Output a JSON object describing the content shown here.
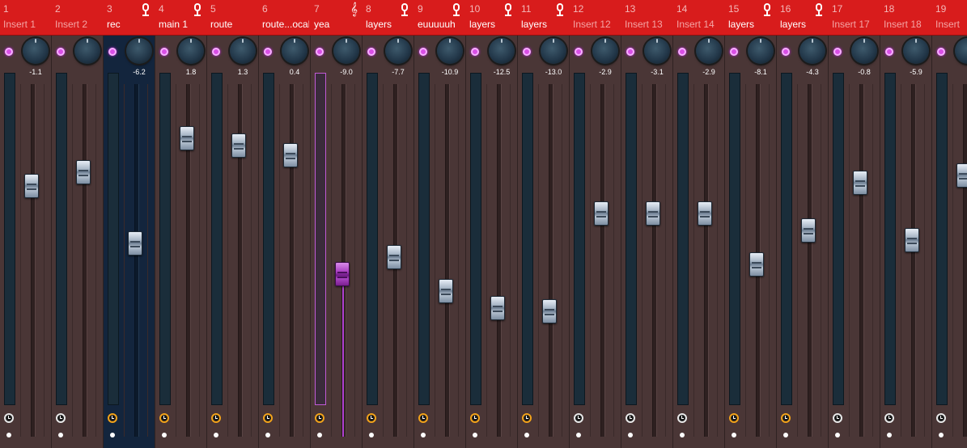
{
  "colors": {
    "header_red": "#d81c1c",
    "strip_bg": "#4a3636",
    "selected_strip_bg": "#13253d",
    "led_magenta": "#d94fe6",
    "active_fader_purple": "#a83ec0",
    "clock_orange": "#f2a31b"
  },
  "strips": [
    {
      "number": "1",
      "name": "Insert 1",
      "custom": false,
      "volume": "-1.1",
      "level": 0.7,
      "icon": "",
      "clock": "white-clock-icon",
      "selected": false
    },
    {
      "number": "2",
      "name": "Insert 2",
      "custom": false,
      "volume": "",
      "level": 0.74,
      "icon": "",
      "clock": "white-clock-icon",
      "selected": false
    },
    {
      "number": "3",
      "name": "rec",
      "custom": true,
      "volume": "-6.2",
      "level": 0.53,
      "icon": "mic-icon",
      "clock": "orange-clock-icon",
      "selected": true
    },
    {
      "number": "4",
      "name": "main 1",
      "custom": true,
      "volume": "1.8",
      "level": 0.84,
      "icon": "mic-icon",
      "clock": "orange-clock-icon",
      "selected": false
    },
    {
      "number": "5",
      "name": "route",
      "custom": true,
      "volume": "1.3",
      "level": 0.82,
      "icon": "",
      "clock": "orange-clock-icon",
      "selected": false
    },
    {
      "number": "6",
      "name": "route...ocals",
      "custom": true,
      "volume": "0.4",
      "level": 0.79,
      "icon": "",
      "clock": "orange-clock-icon",
      "selected": false
    },
    {
      "number": "7",
      "name": "yea",
      "custom": true,
      "volume": "-9.0",
      "level": 0.44,
      "icon": "treble-clef-icon",
      "clock": "orange-clock-icon",
      "selected": false,
      "active": true
    },
    {
      "number": "8",
      "name": "layers",
      "custom": true,
      "volume": "-7.7",
      "level": 0.49,
      "icon": "mic-icon",
      "clock": "orange-clock-icon",
      "selected": false
    },
    {
      "number": "9",
      "name": "euuuuuh",
      "custom": true,
      "volume": "-10.9",
      "level": 0.39,
      "icon": "mic-icon",
      "clock": "orange-clock-icon",
      "selected": false
    },
    {
      "number": "10",
      "name": "layers",
      "custom": true,
      "volume": "-12.5",
      "level": 0.34,
      "icon": "mic-icon",
      "clock": "orange-clock-icon",
      "selected": false
    },
    {
      "number": "11",
      "name": "layers",
      "custom": true,
      "volume": "-13.0",
      "level": 0.33,
      "icon": "mic-icon",
      "clock": "orange-clock-icon",
      "selected": false
    },
    {
      "number": "12",
      "name": "Insert 12",
      "custom": false,
      "volume": "-2.9",
      "level": 0.62,
      "icon": "",
      "clock": "white-clock-icon",
      "selected": false
    },
    {
      "number": "13",
      "name": "Insert 13",
      "custom": false,
      "volume": "-3.1",
      "level": 0.62,
      "icon": "",
      "clock": "white-clock-icon",
      "selected": false
    },
    {
      "number": "14",
      "name": "Insert 14",
      "custom": false,
      "volume": "-2.9",
      "level": 0.62,
      "icon": "",
      "clock": "white-clock-icon",
      "selected": false
    },
    {
      "number": "15",
      "name": "layers",
      "custom": true,
      "volume": "-8.1",
      "level": 0.47,
      "icon": "mic-icon",
      "clock": "orange-clock-icon",
      "selected": false
    },
    {
      "number": "16",
      "name": "layers",
      "custom": true,
      "volume": "-4.3",
      "level": 0.57,
      "icon": "mic-icon",
      "clock": "orange-clock-icon",
      "selected": false
    },
    {
      "number": "17",
      "name": "Insert 17",
      "custom": false,
      "volume": "-0.8",
      "level": 0.71,
      "icon": "",
      "clock": "white-clock-icon",
      "selected": false
    },
    {
      "number": "18",
      "name": "Insert 18",
      "custom": false,
      "volume": "-5.9",
      "level": 0.54,
      "icon": "",
      "clock": "white-clock-icon",
      "selected": false
    },
    {
      "number": "19",
      "name": "Insert",
      "custom": false,
      "volume": "",
      "level": 0.73,
      "icon": "",
      "clock": "white-clock-icon",
      "selected": false
    }
  ]
}
